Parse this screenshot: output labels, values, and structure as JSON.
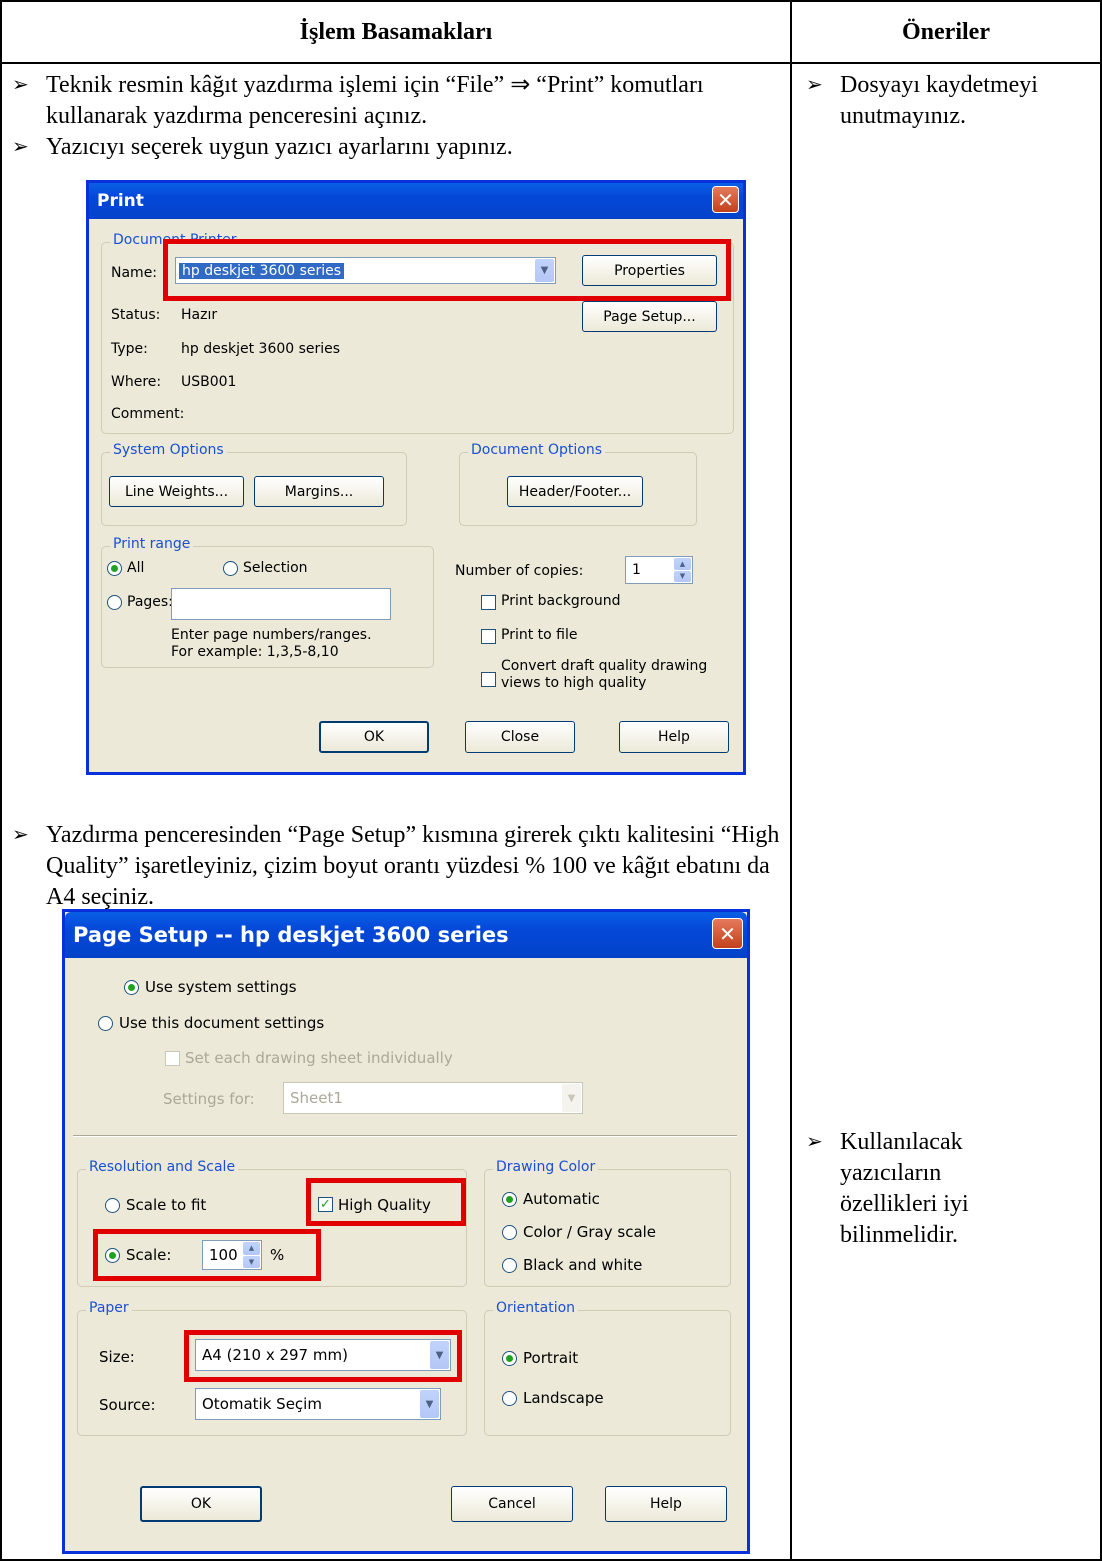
{
  "table": {
    "header_steps": "İşlem Basamakları",
    "header_tips": "Öneriler"
  },
  "steps": [
    "Teknik resmin kâğıt yazdırma işlemi için “File” ⇒ “Print” komutları kullanarak yazdırma penceresini açınız.",
    "Yazıcıyı seçerek uygun yazıcı ayarlarını yapınız.",
    "Yazdırma penceresinden “Page Setup” kısmına girerek çıktı kalitesini “High Quality” işaretleyiniz, çizim boyut orantı yüzdesi % 100 ve kâğıt ebatını da A4 seçiniz."
  ],
  "tips": [
    "Dosyayı kaydetmeyi unutmayınız.",
    "Kullanılacak yazıcıların özellikleri iyi bilinmelidir."
  ],
  "bullet_glyph": "➢",
  "print_dialog": {
    "title": "Print",
    "close_glyph": "✕",
    "document_printer": {
      "group_label": "Document Printer",
      "name_label": "Name:",
      "name_value": "hp deskjet 3600 series",
      "status_label": "Status:",
      "status_value": "Hazır",
      "type_label": "Type:",
      "type_value": "hp deskjet 3600 series",
      "where_label": "Where:",
      "where_value": "USB001",
      "comment_label": "Comment:",
      "properties_button": "Properties",
      "page_setup_button": "Page Setup..."
    },
    "system_options": {
      "group_label": "System Options",
      "line_weights_button": "Line Weights...",
      "margins_button": "Margins..."
    },
    "document_options": {
      "group_label": "Document Options",
      "header_footer_button": "Header/Footer..."
    },
    "print_range": {
      "group_label": "Print range",
      "all_label": "All",
      "selection_label": "Selection",
      "pages_label": "Pages:",
      "hint_line1": "Enter page numbers/ranges.",
      "hint_line2": "For example: 1,3,5-8,10"
    },
    "copies_label": "Number of copies:",
    "copies_value": "1",
    "print_background_label": "Print background",
    "print_to_file_label": "Print to file",
    "convert_line1": "Convert draft quality drawing",
    "convert_line2": "views to high quality",
    "ok_button": "OK",
    "close_button": "Close",
    "help_button": "Help"
  },
  "page_setup_dialog": {
    "title": "Page Setup -- hp deskjet 3600 series",
    "close_glyph": "✕",
    "use_system_settings": "Use system settings",
    "use_document_settings": "Use this document settings",
    "set_each_sheet": "Set each drawing sheet individually",
    "settings_for_label": "Settings for:",
    "settings_for_value": "Sheet1",
    "resolution": {
      "group_label": "Resolution and Scale",
      "scale_to_fit_label": "Scale to fit",
      "high_quality_label": "High Quality",
      "scale_label": "Scale:",
      "scale_value": "100",
      "percent_label": "%"
    },
    "drawing_color": {
      "group_label": "Drawing Color",
      "automatic": "Automatic",
      "color_gray": "Color / Gray scale",
      "black_white": "Black and white"
    },
    "paper": {
      "group_label": "Paper",
      "size_label": "Size:",
      "size_value": "A4 (210 x 297 mm)",
      "source_label": "Source:",
      "source_value": "Otomatik Seçim"
    },
    "orientation": {
      "group_label": "Orientation",
      "portrait": "Portrait",
      "landscape": "Landscape"
    },
    "ok_button": "OK",
    "cancel_button": "Cancel",
    "help_button": "Help"
  },
  "colors": {
    "highlight_red": "#e00000",
    "xp_blue": "#0831d9",
    "dialog_bg": "#ece9d8"
  }
}
